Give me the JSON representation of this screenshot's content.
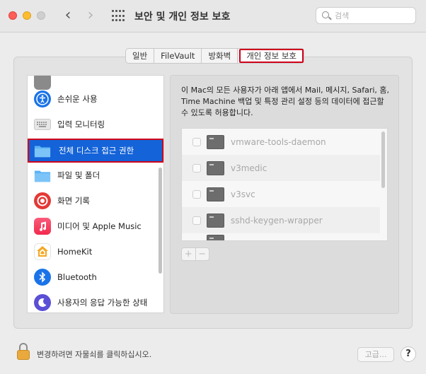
{
  "window": {
    "title": "보안 및 개인 정보 보호",
    "search_placeholder": "검색"
  },
  "tabs": [
    {
      "label": "일반",
      "active": false
    },
    {
      "label": "FileVault",
      "active": false
    },
    {
      "label": "방화벽",
      "active": false
    },
    {
      "label": "개인 정보 보호",
      "active": true
    }
  ],
  "sidebar": {
    "items": [
      {
        "label": "손쉬운 사용",
        "icon": "accessibility-icon",
        "color": "#1a73e8"
      },
      {
        "label": "입력 모니터링",
        "icon": "keyboard-icon",
        "color": "#e0e0e0"
      },
      {
        "label": "전체 디스크 접근 권한",
        "icon": "folder-icon",
        "color": "#4aa8f0",
        "selected": true
      },
      {
        "label": "파일 및 폴더",
        "icon": "folder-icon",
        "color": "#4aa8f0"
      },
      {
        "label": "화면 기록",
        "icon": "screen-record-icon",
        "color": "#e53935"
      },
      {
        "label": "미디어 및 Apple Music",
        "icon": "music-icon",
        "color": "#f5365c"
      },
      {
        "label": "HomeKit",
        "icon": "home-icon",
        "color": "#ffffff"
      },
      {
        "label": "Bluetooth",
        "icon": "bluetooth-icon",
        "color": "#1a73e8"
      },
      {
        "label": "사용자의 응답 가능한 상태",
        "icon": "moon-icon",
        "color": "#5b4fd6"
      }
    ]
  },
  "main": {
    "description": "이 Mac의 모든 사용자가 아래 앱에서 Mail, 메시지, Safari, 홈, Time Machine 백업 및 특정 관리 설정 등의 데이터에 접근할 수 있도록 허용합니다.",
    "apps": [
      {
        "name": "vmware-tools-daemon",
        "checked": false
      },
      {
        "name": "v3medic",
        "checked": false
      },
      {
        "name": "v3svc",
        "checked": false
      },
      {
        "name": "sshd-keygen-wrapper",
        "checked": false
      }
    ],
    "add_label": "+",
    "remove_label": "−"
  },
  "footer": {
    "lock_text": "변경하려면 자물쇠를 클릭하십시오.",
    "advanced_label": "고급...",
    "help_label": "?"
  }
}
